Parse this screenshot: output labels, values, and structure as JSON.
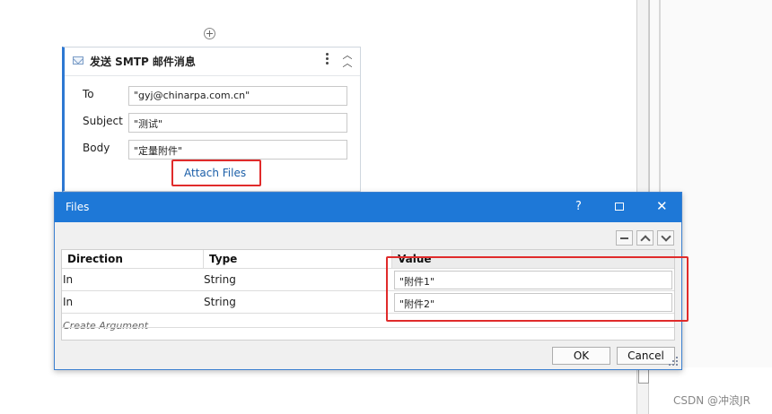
{
  "activity": {
    "title": "发送 SMTP 邮件消息",
    "fields": [
      {
        "label": "To",
        "value": "\"gyj@chinarpa.com.cn\""
      },
      {
        "label": "Subject",
        "value": "\"测试\""
      },
      {
        "label": "Body",
        "value": "\"定量附件\""
      }
    ],
    "attach_label": "Attach Files"
  },
  "dialog": {
    "title": "Files",
    "help": "?",
    "close": "✕",
    "columns": {
      "direction": "Direction",
      "type": "Type",
      "value": "Value"
    },
    "rows": [
      {
        "direction": "In",
        "type": "String",
        "value": "\"附件1\""
      },
      {
        "direction": "In",
        "type": "String",
        "value": "\"附件2\""
      }
    ],
    "create_argument": "Create Argument",
    "ok_label": "OK",
    "cancel_label": "Cancel"
  },
  "watermark": "CSDN @冲浪JR",
  "colors": {
    "accent": "#1e78d7",
    "highlight": "#e02b2b",
    "link": "#1a5ea8"
  }
}
